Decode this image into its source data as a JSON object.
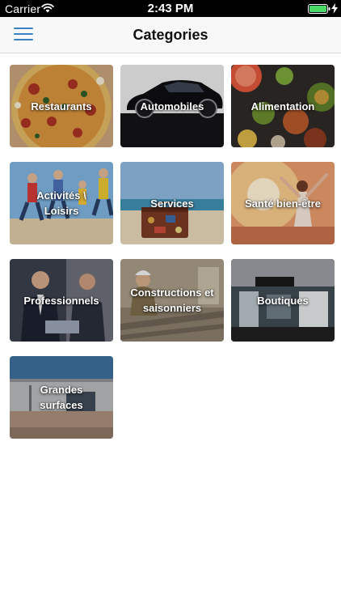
{
  "status_bar": {
    "carrier": "Carrier",
    "time": "2:43 PM",
    "icons": [
      "wifi-icon",
      "battery-icon",
      "charging-bolt-icon"
    ]
  },
  "nav_bar": {
    "title": "Categories",
    "menu_icon": "hamburger-menu-icon"
  },
  "colors": {
    "accent": "#3b82c4",
    "battery": "#4cd964",
    "nav_background": "#f8f8f8"
  },
  "categories": [
    {
      "label": "Restaurants",
      "icon": "pizza-photo"
    },
    {
      "label": "Automobiles",
      "icon": "car-photo"
    },
    {
      "label": "Alimentation",
      "icon": "food-photo"
    },
    {
      "label": "Activités \\ Loisirs",
      "icon": "jumping-people-photo"
    },
    {
      "label": "Services",
      "icon": "suitcase-beach-photo"
    },
    {
      "label": "Santé bien-être",
      "icon": "wellness-photo"
    },
    {
      "label": "Professionnels",
      "icon": "business-people-photo"
    },
    {
      "label": "Constructions et saisonniers",
      "icon": "construction-worker-photo"
    },
    {
      "label": "Boutiques",
      "icon": "boutique-storefront-photo"
    },
    {
      "label": "Grandes surfaces",
      "icon": "warehouse-photo"
    }
  ]
}
